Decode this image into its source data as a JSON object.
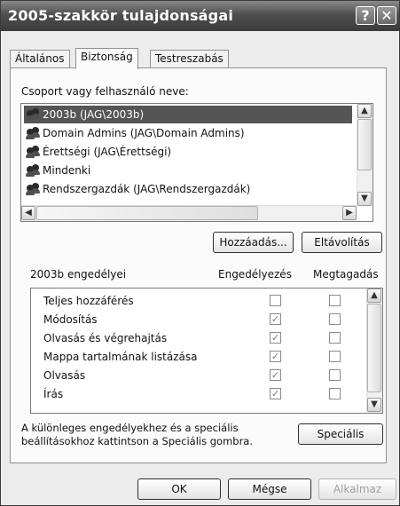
{
  "window": {
    "title": "2005-szakkör tulajdonságai",
    "help_glyph": "?",
    "close_glyph": "✕"
  },
  "tabs": [
    {
      "label": "Általános"
    },
    {
      "label": "Biztonság"
    },
    {
      "label": "Testreszabás"
    }
  ],
  "security": {
    "group_label": "Csoport vagy felhasználó neve:",
    "principals": [
      {
        "name": "2003b (JAG\\2003b)",
        "selected": true
      },
      {
        "name": "Domain Admins (JAG\\Domain Admins)"
      },
      {
        "name": "Érettségi (JAG\\Érettségi)"
      },
      {
        "name": "Mindenki"
      },
      {
        "name": "Rendszergazdák (JAG\\Rendszergazdák)"
      }
    ],
    "add_label": "Hozzáadás...",
    "remove_label": "Eltávolítás",
    "perm_title": "2003b engedélyei",
    "allow_header": "Engedélyezés",
    "deny_header": "Megtagadás",
    "permissions": [
      {
        "name": "Teljes hozzáférés",
        "allow": false,
        "deny": false
      },
      {
        "name": "Módosítás",
        "allow": true,
        "deny": false
      },
      {
        "name": "Olvasás és végrehajtás",
        "allow": true,
        "deny": false
      },
      {
        "name": "Mappa tartalmának listázása",
        "allow": true,
        "deny": false
      },
      {
        "name": "Olvasás",
        "allow": true,
        "deny": false
      },
      {
        "name": "Írás",
        "allow": true,
        "deny": false
      }
    ],
    "special_text_1": "A különleges engedélyekhez és a speciális",
    "special_text_2": "beállításokhoz kattintson a Speciális gombra.",
    "special_label": "Speciális"
  },
  "footer": {
    "ok_label": "OK",
    "cancel_label": "Mégse",
    "apply_label": "Alkalmaz"
  },
  "icons": {
    "checkmark": "✓",
    "up_arrow": "▲",
    "down_arrow": "▼",
    "left_arrow": "◀",
    "right_arrow": "▶"
  }
}
